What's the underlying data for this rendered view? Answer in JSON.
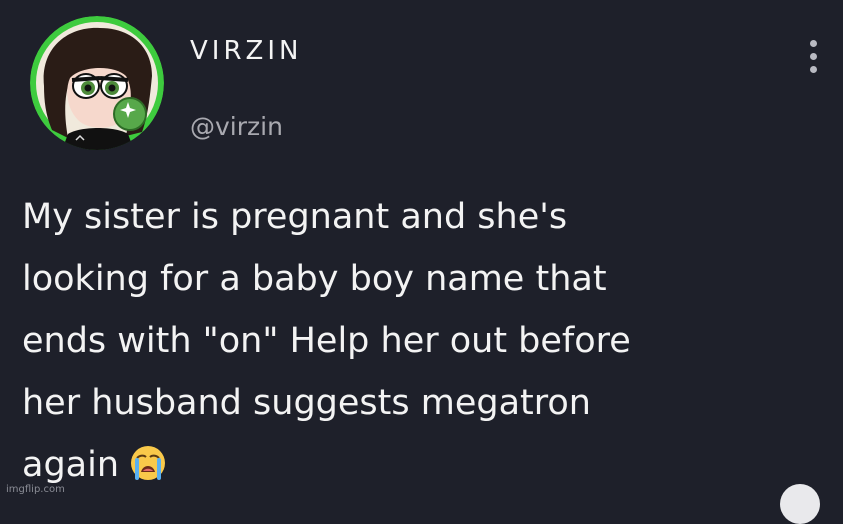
{
  "post": {
    "display_name": "VIRZIN",
    "handle": "@virzin",
    "lines": [
      "My sister is pregnant and she's",
      "looking for a baby boy name that",
      "ends with \"on\" Help her out before",
      "her husband suggests megatron",
      "again"
    ],
    "emoji": "loudly-crying-face"
  },
  "avatar": {
    "ring_color": "#3ecb3e",
    "character": "green-cartoon-girl"
  },
  "menu": {
    "icon": "more-vertical-icon"
  },
  "watermark": {
    "text": "imgflip.com"
  },
  "colors": {
    "background": "#1e202a",
    "text": "#f3f3f3",
    "handle": "#a9a9b0"
  }
}
